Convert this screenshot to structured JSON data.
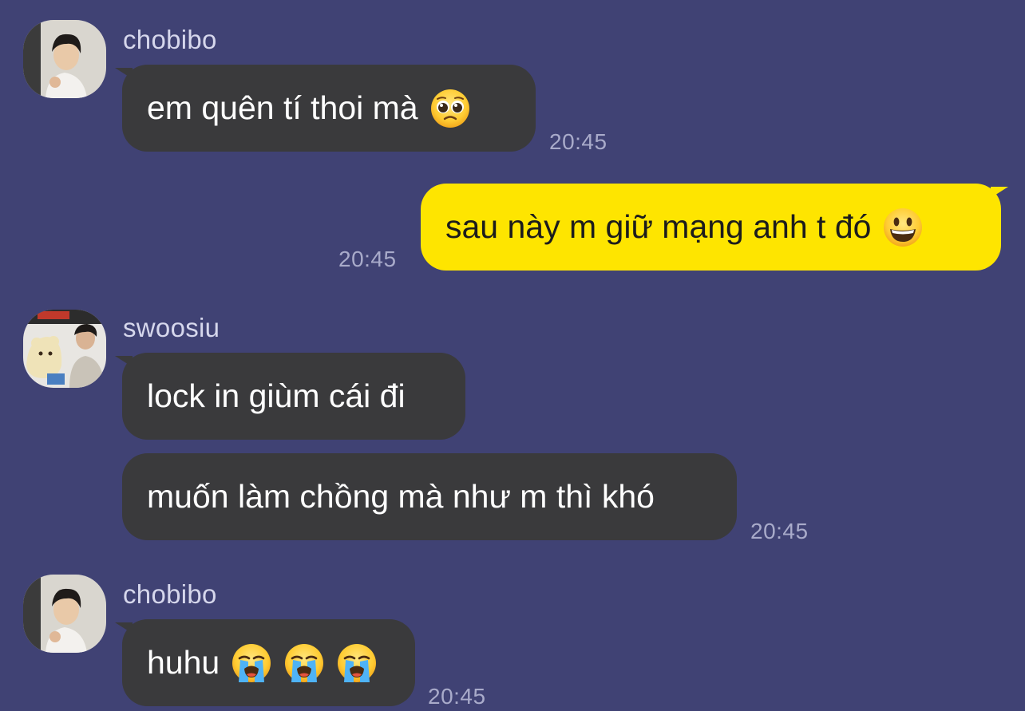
{
  "messages": [
    {
      "id": "m1",
      "direction": "incoming",
      "sender": "chobibo",
      "avatar": "chobibo-avatar",
      "text": "em quên tí thoi mà",
      "emoji": [
        "pleading-face-icon"
      ],
      "time": "20:45"
    },
    {
      "id": "m2",
      "direction": "outgoing",
      "text": "sau này m giữ mạng anh t đó",
      "emoji": [
        "grinning-face-icon"
      ],
      "time": "20:45"
    },
    {
      "id": "m3",
      "direction": "incoming",
      "sender": "swoosiu",
      "avatar": "swoosiu-avatar",
      "text": "lock in giùm cái đi",
      "emoji": []
    },
    {
      "id": "m4",
      "direction": "incoming",
      "text": "muốn làm chồng mà như m thì khó",
      "emoji": [],
      "time": "20:45"
    },
    {
      "id": "m5",
      "direction": "incoming",
      "sender": "chobibo",
      "avatar": "chobibo-avatar",
      "text": "huhu",
      "emoji": [
        "loudly-crying-face-icon",
        "loudly-crying-face-icon",
        "loudly-crying-face-icon"
      ],
      "time": "20:45"
    }
  ],
  "colors": {
    "background": "#404274",
    "incoming_bubble": "#3a3a3c",
    "outgoing_bubble": "#fee500",
    "sender_name": "#d6d7ec",
    "timestamp": "#a9abca"
  }
}
